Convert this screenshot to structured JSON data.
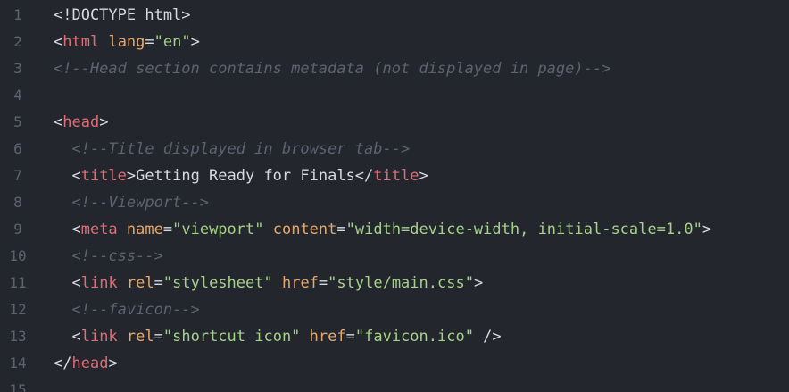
{
  "colors": {
    "background": "#23262d",
    "gutter": "#5c6370",
    "text": "#d7dae0",
    "tag": "#e06c75",
    "attribute": "#e5a86a",
    "string": "#a6d189",
    "comment": "#5c6370"
  },
  "lines": [
    {
      "num": "1",
      "tokens": [
        {
          "t": "punct",
          "v": "<!DOCTYPE html>"
        }
      ]
    },
    {
      "num": "2",
      "tokens": [
        {
          "t": "punct",
          "v": "<"
        },
        {
          "t": "tag",
          "v": "html"
        },
        {
          "t": "punct",
          "v": " "
        },
        {
          "t": "attr",
          "v": "lang"
        },
        {
          "t": "punct",
          "v": "="
        },
        {
          "t": "str",
          "v": "\"en\""
        },
        {
          "t": "punct",
          "v": ">"
        }
      ]
    },
    {
      "num": "3",
      "tokens": [
        {
          "t": "cmt",
          "v": "<!--Head section contains metadata (not displayed in page)-->"
        }
      ]
    },
    {
      "num": "4",
      "tokens": []
    },
    {
      "num": "5",
      "tokens": [
        {
          "t": "punct",
          "v": "<"
        },
        {
          "t": "tag",
          "v": "head"
        },
        {
          "t": "punct",
          "v": ">"
        }
      ]
    },
    {
      "num": "6",
      "tokens": [
        {
          "t": "punct",
          "v": "  "
        },
        {
          "t": "cmt",
          "v": "<!--Title displayed in browser tab-->"
        }
      ]
    },
    {
      "num": "7",
      "tokens": [
        {
          "t": "punct",
          "v": "  <"
        },
        {
          "t": "tag",
          "v": "title"
        },
        {
          "t": "punct",
          "v": ">"
        },
        {
          "t": "text",
          "v": "Getting Ready for Finals"
        },
        {
          "t": "punct",
          "v": "</"
        },
        {
          "t": "tag",
          "v": "title"
        },
        {
          "t": "punct",
          "v": ">"
        }
      ]
    },
    {
      "num": "8",
      "tokens": [
        {
          "t": "punct",
          "v": "  "
        },
        {
          "t": "cmt",
          "v": "<!--Viewport-->"
        }
      ]
    },
    {
      "num": "9",
      "tokens": [
        {
          "t": "punct",
          "v": "  <"
        },
        {
          "t": "tag",
          "v": "meta"
        },
        {
          "t": "punct",
          "v": " "
        },
        {
          "t": "attr",
          "v": "name"
        },
        {
          "t": "punct",
          "v": "="
        },
        {
          "t": "str",
          "v": "\"viewport\""
        },
        {
          "t": "punct",
          "v": " "
        },
        {
          "t": "attr",
          "v": "content"
        },
        {
          "t": "punct",
          "v": "="
        },
        {
          "t": "str",
          "v": "\"width=device-width, initial-scale=1.0\""
        },
        {
          "t": "punct",
          "v": ">"
        }
      ]
    },
    {
      "num": "10",
      "tokens": [
        {
          "t": "punct",
          "v": "  "
        },
        {
          "t": "cmt",
          "v": "<!--css-->"
        }
      ]
    },
    {
      "num": "11",
      "tokens": [
        {
          "t": "punct",
          "v": "  <"
        },
        {
          "t": "tag",
          "v": "link"
        },
        {
          "t": "punct",
          "v": " "
        },
        {
          "t": "attr",
          "v": "rel"
        },
        {
          "t": "punct",
          "v": "="
        },
        {
          "t": "str",
          "v": "\"stylesheet\""
        },
        {
          "t": "punct",
          "v": " "
        },
        {
          "t": "attr",
          "v": "href"
        },
        {
          "t": "punct",
          "v": "="
        },
        {
          "t": "str",
          "v": "\"style/main.css\""
        },
        {
          "t": "punct",
          "v": ">"
        }
      ]
    },
    {
      "num": "12",
      "tokens": [
        {
          "t": "punct",
          "v": "  "
        },
        {
          "t": "cmt",
          "v": "<!--favicon-->"
        }
      ]
    },
    {
      "num": "13",
      "tokens": [
        {
          "t": "punct",
          "v": "  <"
        },
        {
          "t": "tag",
          "v": "link"
        },
        {
          "t": "punct",
          "v": " "
        },
        {
          "t": "attr",
          "v": "rel"
        },
        {
          "t": "punct",
          "v": "="
        },
        {
          "t": "str",
          "v": "\"shortcut icon\""
        },
        {
          "t": "punct",
          "v": " "
        },
        {
          "t": "attr",
          "v": "href"
        },
        {
          "t": "punct",
          "v": "="
        },
        {
          "t": "str",
          "v": "\"favicon.ico\""
        },
        {
          "t": "punct",
          "v": " />"
        }
      ]
    },
    {
      "num": "14",
      "tokens": [
        {
          "t": "punct",
          "v": "</"
        },
        {
          "t": "tag",
          "v": "head"
        },
        {
          "t": "punct",
          "v": ">"
        }
      ]
    },
    {
      "num": "15",
      "tokens": []
    }
  ]
}
